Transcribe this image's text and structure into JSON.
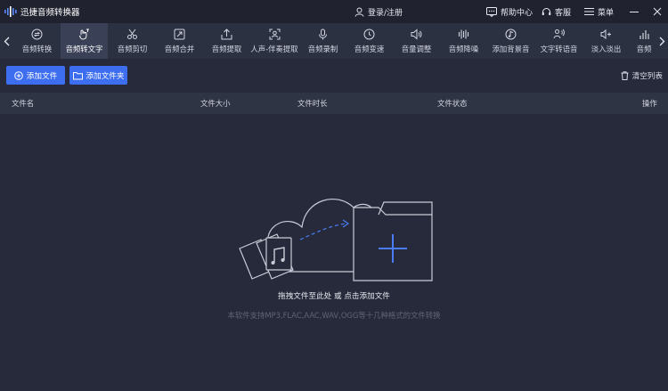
{
  "app": {
    "title": "迅捷音频转换器"
  },
  "titlebar": {
    "login_label": "登录/注册",
    "help_label": "帮助中心",
    "service_label": "客服",
    "menu_label": "菜单"
  },
  "toolbar": {
    "tools": [
      {
        "label": "音频转换",
        "icon": "swap-icon"
      },
      {
        "label": "音频转文字",
        "icon": "hand-text-icon"
      },
      {
        "label": "音频剪切",
        "icon": "scissors-icon"
      },
      {
        "label": "音频合并",
        "icon": "merge-icon"
      },
      {
        "label": "音频提取",
        "icon": "extract-icon"
      },
      {
        "label": "人声-伴奏提取",
        "icon": "vocal-extract-icon"
      },
      {
        "label": "音频录制",
        "icon": "microphone-icon"
      },
      {
        "label": "音频变速",
        "icon": "speed-icon"
      },
      {
        "label": "音量调整",
        "icon": "volume-icon"
      },
      {
        "label": "音频降噪",
        "icon": "denoise-icon"
      },
      {
        "label": "添加背景音",
        "icon": "bg-music-icon"
      },
      {
        "label": "文字转语音",
        "icon": "text-to-speech-icon"
      },
      {
        "label": "淡入淡出",
        "icon": "fade-icon"
      },
      {
        "label": "音频",
        "icon": "bars-icon"
      }
    ],
    "active_index": 1
  },
  "actions": {
    "add_file_label": "添加文件",
    "add_folder_label": "添加文件夹",
    "clear_list_label": "清空列表"
  },
  "table": {
    "columns": [
      "文件名",
      "文件大小",
      "文件时长",
      "文件状态",
      "操作"
    ]
  },
  "empty": {
    "drop_hint": "拖拽文件至此处 或 点击添加文件",
    "support_hint": "本软件支持MP3,FLAC,AAC,WAV,OGG等十几种格式的文件转换"
  },
  "colors": {
    "background": "#262a3a",
    "titlebar": "#20232f",
    "toolbar": "#2c3142",
    "accent": "#3e6ef0"
  }
}
